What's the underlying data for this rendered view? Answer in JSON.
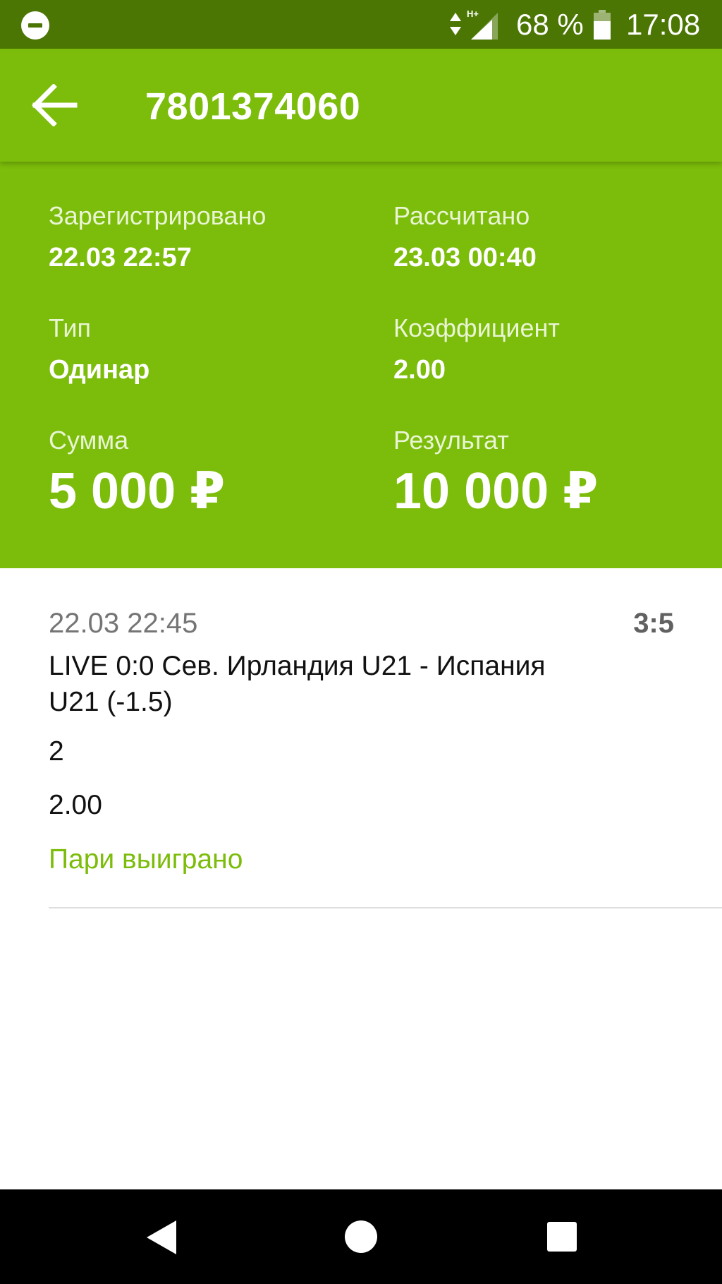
{
  "status_bar": {
    "battery": "68 %",
    "time": "17:08",
    "network_type": "H+",
    "icons": [
      "do-not-disturb-icon",
      "data-arrows-icon",
      "signal-icon",
      "battery-icon"
    ]
  },
  "app_bar": {
    "title": "7801374060",
    "back_icon": "arrow-left-icon"
  },
  "summary": {
    "registered": {
      "label": "Зарегистрировано",
      "value": "22.03 22:57"
    },
    "settled": {
      "label": "Рассчитано",
      "value": "23.03 00:40"
    },
    "type": {
      "label": "Тип",
      "value": "Одинар"
    },
    "coefficient": {
      "label": "Коэффициент",
      "value": "2.00"
    },
    "amount": {
      "label": "Сумма",
      "value": "5 000 ₽"
    },
    "result": {
      "label": "Результат",
      "value": "10 000 ₽"
    }
  },
  "bet_items": [
    {
      "date": "22.03 22:45",
      "score": "3:5",
      "event": "LIVE 0:0 Сев. Ирландия U21 - Испания U21 (-1.5)",
      "outcome": "2",
      "coefficient": "2.00",
      "status": "Пари выиграно"
    }
  ],
  "nav_bar": {
    "icons": [
      "nav-back-icon",
      "nav-home-icon",
      "nav-recent-apps-icon"
    ]
  },
  "colors": {
    "accent": "#7cbc0a",
    "status_bar": "#4b7603",
    "win_text": "#7cbc0a"
  }
}
